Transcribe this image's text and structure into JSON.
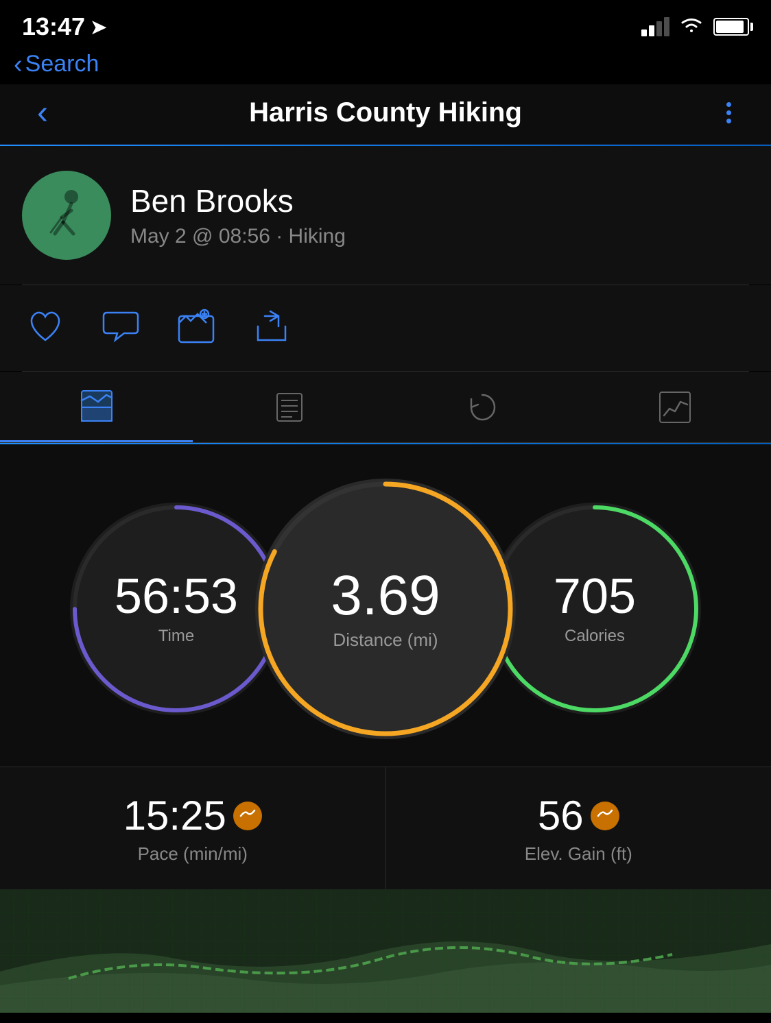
{
  "statusBar": {
    "time": "13:47",
    "hasLocationArrow": true
  },
  "backNav": {
    "label": "Search"
  },
  "header": {
    "backIcon": "‹",
    "title": "Harris County Hiking",
    "moreDotsLabel": "more options"
  },
  "profile": {
    "name": "Ben Brooks",
    "meta": "May 2 @ 08:56 · Hiking"
  },
  "actions": {
    "likeLabel": "like",
    "commentLabel": "comment",
    "cameraLabel": "add photo",
    "shareLabel": "share"
  },
  "tabs": [
    {
      "id": "overview",
      "label": "Overview",
      "active": true
    },
    {
      "id": "splits",
      "label": "Splits",
      "active": false
    },
    {
      "id": "laps",
      "label": "Laps",
      "active": false
    },
    {
      "id": "charts",
      "label": "Charts",
      "active": false
    }
  ],
  "stats": {
    "time": {
      "value": "56:53",
      "label": "Time",
      "ringColor": "#6a5acd"
    },
    "distance": {
      "value": "3.69",
      "label": "Distance (mi)",
      "ringColor": "#f5a623"
    },
    "calories": {
      "value": "705",
      "label": "Calories",
      "ringColor": "#4cd964"
    }
  },
  "metrics": [
    {
      "value": "15:25",
      "label": "Pace (min/mi)",
      "hasBadge": true
    },
    {
      "value": "56",
      "label": "Elev. Gain (ft)",
      "hasBadge": true
    }
  ]
}
